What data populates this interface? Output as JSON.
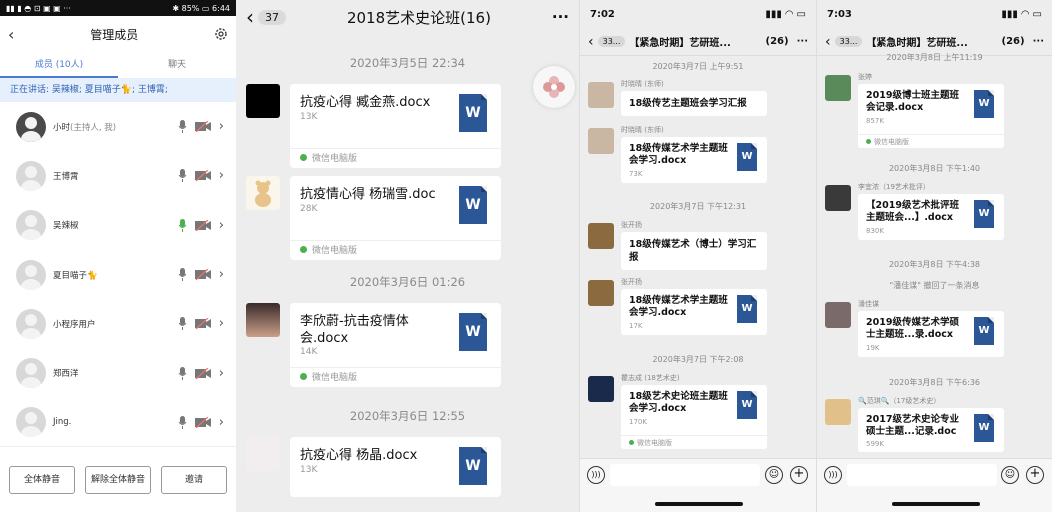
{
  "panel1": {
    "status_left": "▮▮ ▮ ◓ ⊡ ▣ ▣ ···",
    "status_right": "✱ 85% ▭ 6:44",
    "title": "管理成员",
    "tab_members": "成员 (10人)",
    "tab_chat": "聊天",
    "speaking": "正在讲话: 吴辣椒; 夏目喵子🐈; 王博霄;",
    "members": [
      {
        "name": "小时",
        "sub": "(主持人, 我)"
      },
      {
        "name": "王博霄",
        "sub": ""
      },
      {
        "name": "吴辣椒",
        "sub": ""
      },
      {
        "name": "夏目喵子🐈",
        "sub": ""
      },
      {
        "name": "小程序用户",
        "sub": ""
      },
      {
        "name": "郑西洋",
        "sub": ""
      },
      {
        "name": "Jing.",
        "sub": ""
      }
    ],
    "btn_mute_all": "全体静音",
    "btn_unmute_all": "解除全体静音",
    "btn_invite": "邀请"
  },
  "panel2": {
    "back_count": "37",
    "title": "2018艺术史论班(16)",
    "more": "···",
    "timestamps": [
      "2020年3月5日 22:34",
      "2020年3月6日 01:26",
      "2020年3月6日 12:55"
    ],
    "messages": [
      {
        "filename": "抗疫心得 臧金燕.docx",
        "size": "13K",
        "source": "微信电脑版"
      },
      {
        "filename": "抗疫情心得 杨瑞雪.doc",
        "size": "28K",
        "source": "微信电脑版"
      },
      {
        "filename": "李欣蔚-抗击疫情体会.docx",
        "size": "14K",
        "source": "微信电脑版"
      },
      {
        "filename": "抗疫心得  杨晶.docx",
        "size": "13K",
        "source": ""
      }
    ],
    "word_letter": "W"
  },
  "panel3": {
    "time": "7:02",
    "back_count": "33...",
    "title": "【紧急时期】艺研班...",
    "count": "(26)",
    "more": "···",
    "items": [
      {
        "ts": "2020年3月7日 上午9:51",
        "sender": "时晓晴 (东师)",
        "text": "18级传艺主题班会学习汇报",
        "size": "",
        "source": ""
      },
      {
        "ts": "",
        "sender": "时晓晴 (东师)",
        "text": "18级传媒艺术学主题班会学习.docx",
        "size": "73K",
        "source": ""
      },
      {
        "ts": "2020年3月7日 下午12:31",
        "sender": "张开扬",
        "text": "18级传媒艺术（博士）学习汇报",
        "size": "",
        "source": ""
      },
      {
        "ts": "",
        "sender": "张开扬",
        "text": "18级传媒艺术学主题班会学习.docx",
        "size": "17K",
        "source": ""
      },
      {
        "ts": "2020年3月7日 下午2:08",
        "sender": "瞿志成 (18艺术史)",
        "text": "18级艺术史论班主题班会学习.docx",
        "size": "170K",
        "source": "微信电脑版"
      }
    ]
  },
  "panel4": {
    "time": "7:03",
    "back_count": "33...",
    "title": "【紧急时期】艺研班...",
    "count": "(26)",
    "more": "···",
    "top_ts": "2020年3月8日 上午11:19",
    "items": [
      {
        "ts": "",
        "sender": "张婷",
        "text": "2019级博士班主题班会记录.docx",
        "size": "857K",
        "source": "微信电脑版"
      },
      {
        "ts": "2020年3月8日 下午1:40",
        "sender": "李宜浓（19艺术批评）",
        "text": "【2019级艺术批评班主题班会...】.docx",
        "size": "830K",
        "source": ""
      },
      {
        "ts": "2020年3月8日 下午4:38",
        "sender": "潘佳谋",
        "text": "2019级传媒艺术学硕士主题班...录.docx",
        "size": "19K",
        "source": ""
      },
      {
        "ts": "2020年3月8日 下午6:36",
        "sender": "🔍范琪🔍（17级艺术史）",
        "text": "2017级艺术史论专业硕士主题...记录.doc",
        "size": "599K",
        "source": ""
      }
    ],
    "recall_notice": "\"潘佳谋\" 撤回了一条消息"
  }
}
